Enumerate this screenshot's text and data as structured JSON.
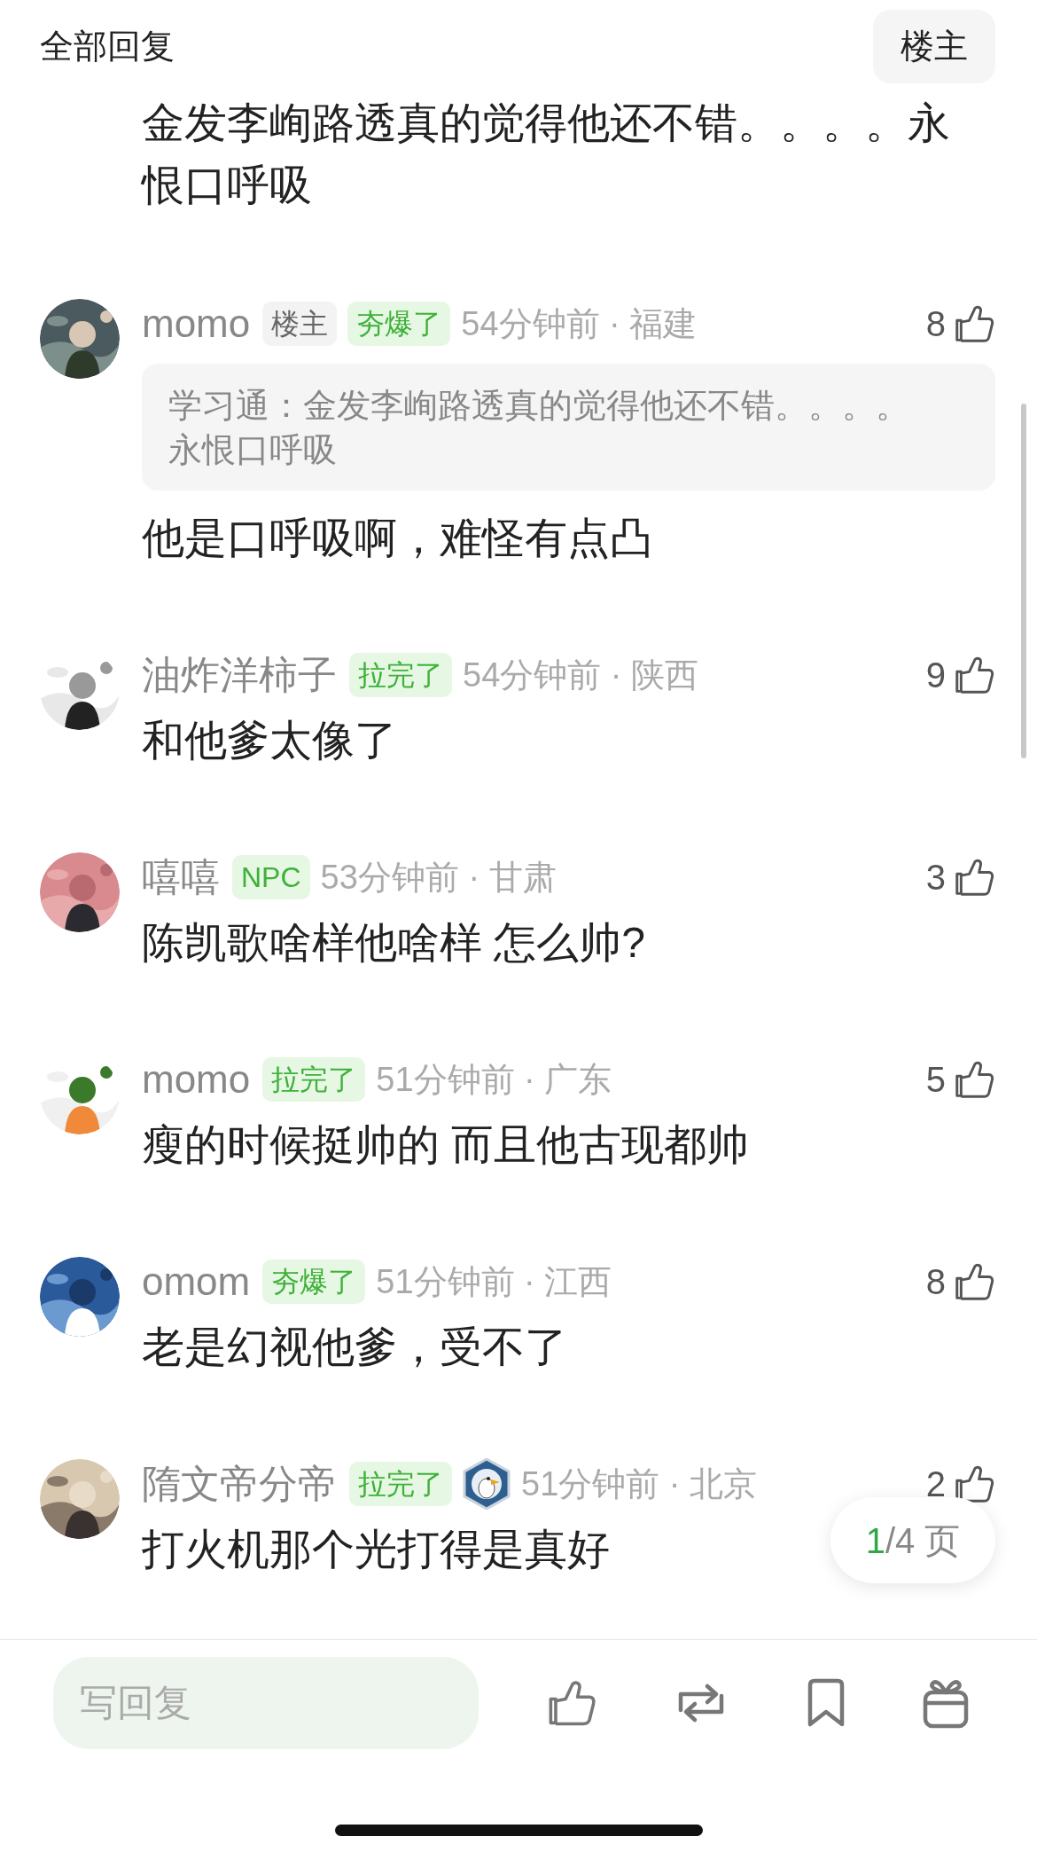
{
  "header": {
    "title": "全部回复",
    "filter_button": "楼主"
  },
  "partial_comment": {
    "text": "金发李峋路透真的觉得他还不错。。。。永恨口呼吸"
  },
  "comments": [
    {
      "user": "momo",
      "tags": [
        {
          "text": "楼主",
          "kind": "op"
        },
        {
          "text": "夯爆了",
          "kind": "rank"
        }
      ],
      "medal": false,
      "meta": "54分钟前 · 福建",
      "likes": "8",
      "quote": "学习通：金发李峋路透真的觉得他还不错。。。。永恨口呼吸",
      "text": "他是口呼吸啊，难怪有点凸"
    },
    {
      "user": "油炸洋柿子",
      "tags": [
        {
          "text": "拉完了",
          "kind": "rank"
        }
      ],
      "medal": false,
      "meta": "54分钟前 · 陕西",
      "likes": "9",
      "text": "和他爹太像了"
    },
    {
      "user": "嘻嘻",
      "tags": [
        {
          "text": "NPC",
          "kind": "rank"
        }
      ],
      "medal": false,
      "meta": "53分钟前 · 甘肃",
      "likes": "3",
      "text": "陈凯歌啥样他啥样 怎么帅?"
    },
    {
      "user": "momo",
      "tags": [
        {
          "text": "拉完了",
          "kind": "rank"
        }
      ],
      "medal": false,
      "meta": "51分钟前 · 广东",
      "likes": "5",
      "text": "瘦的时候挺帅的 而且他古现都帅"
    },
    {
      "user": "omom",
      "tags": [
        {
          "text": "夯爆了",
          "kind": "rank"
        }
      ],
      "medal": false,
      "meta": "51分钟前 · 江西",
      "likes": "8",
      "text": "老是幻视他爹，受不了"
    },
    {
      "user": "隋文帝分帝",
      "tags": [
        {
          "text": "拉完了",
          "kind": "rank"
        }
      ],
      "medal": true,
      "meta": "51分钟前 · 北京",
      "likes": "2",
      "text": "打火机那个光打得是真好"
    }
  ],
  "pager": {
    "current": "1",
    "total": "/4 页"
  },
  "composer": {
    "placeholder": "写回复"
  }
}
